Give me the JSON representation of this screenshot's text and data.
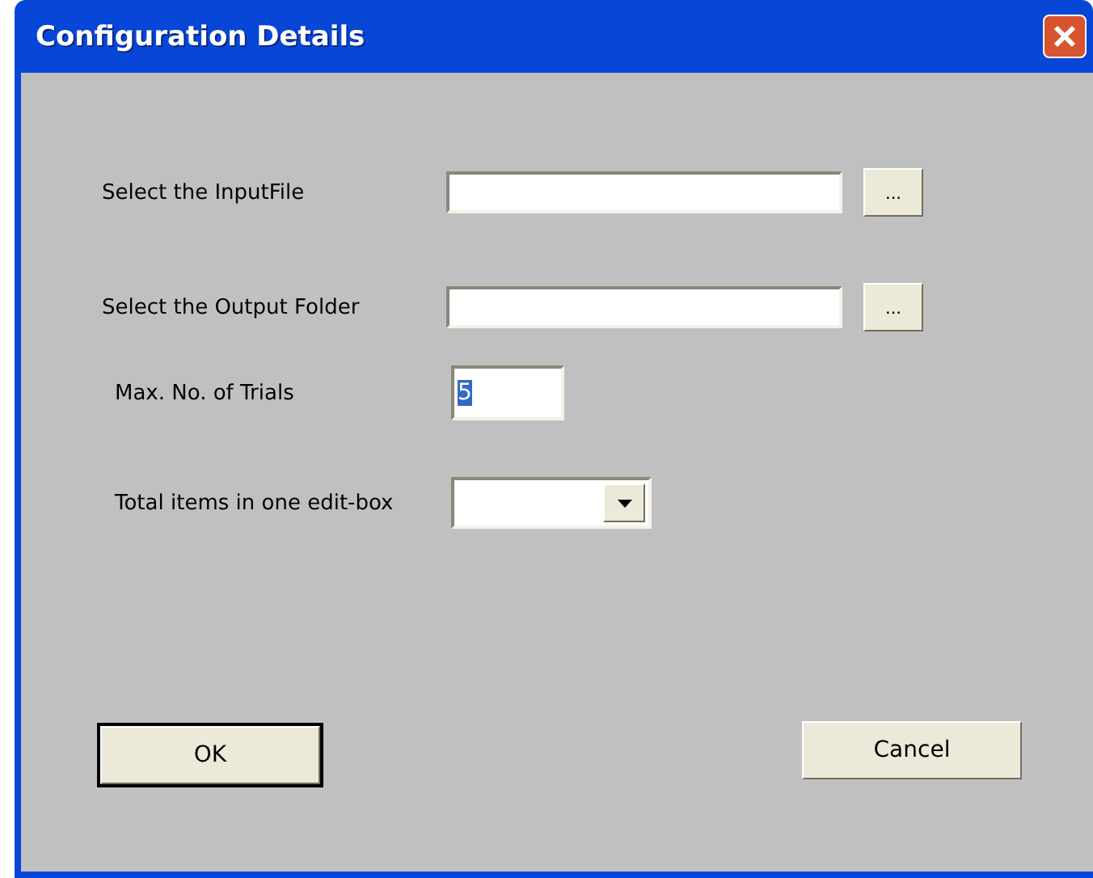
{
  "window": {
    "title": "Configuration Details"
  },
  "rows": [
    {
      "kind": "browse",
      "label": "Select the InputFile",
      "button": "..."
    },
    {
      "kind": "browse",
      "label": "Select the Output Folder",
      "button": "..."
    },
    {
      "kind": "text",
      "label": "Max. No. of Trials",
      "value": "5",
      "text_selected": true
    },
    {
      "kind": "combo",
      "label": "Total items in one edit-box"
    }
  ],
  "buttons": [
    {
      "label": "OK",
      "default": true
    },
    {
      "label": "Cancel",
      "default": false
    }
  ]
}
